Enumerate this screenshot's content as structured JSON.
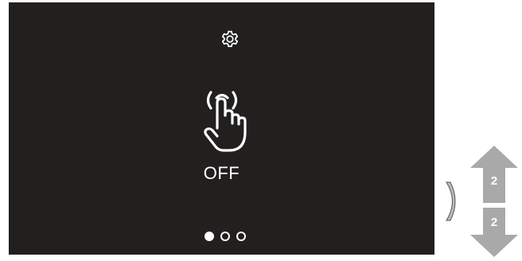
{
  "screen": {
    "settings_icon": "gear-icon",
    "main_icon": "touch-gesture-icon",
    "status_text": "OFF",
    "pager": {
      "total": 3,
      "active_index": 0
    }
  },
  "side_controls": {
    "handle_icon": "chevron-left-bracket-icon",
    "up_arrow": {
      "icon": "arrow-up-icon",
      "label": "2"
    },
    "down_arrow": {
      "icon": "arrow-down-icon",
      "label": "2"
    }
  },
  "colors": {
    "screen_background": "#221f1f",
    "foreground": "#ffffff",
    "arrow_gray": "#a9a9a9"
  }
}
